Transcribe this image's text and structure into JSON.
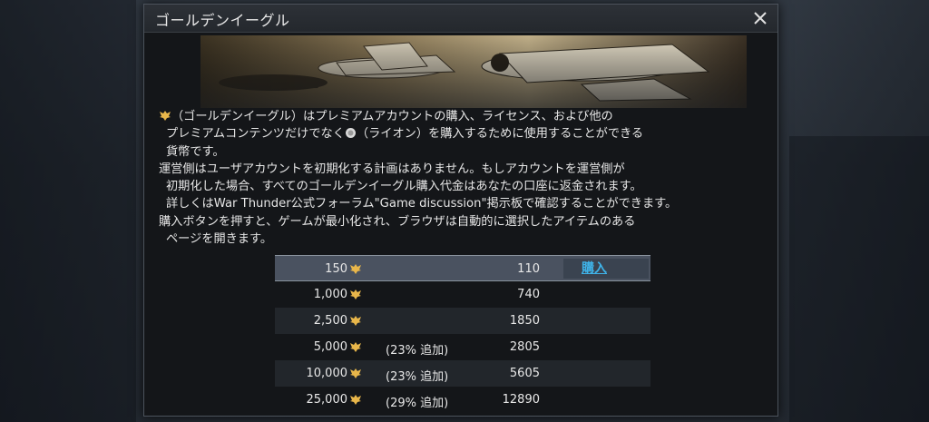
{
  "dialog": {
    "title": "ゴールデンイーグル"
  },
  "description": {
    "p1_line1": "（ゴールデンイーグル）はプレミアムアカウントの購入、ライセンス、および他の",
    "p1_line2a": "プレミアムコンテンツだけでなく",
    "p1_line2b": "（ライオン）を購入するために使用することができる",
    "p1_line3": "貨幣です。",
    "p2_line1": "運営側はユーザアカウントを初期化する計画はありません。もしアカウントを運営側が",
    "p2_line2": "初期化した場合、すべてのゴールデンイーグル購入代金はあなたの口座に返金されます。",
    "p2_line3": "詳しくはWar Thunder公式フォーラム\"Game discussion\"掲示板で確認することができます。",
    "p3_line1": "購入ボタンを押すと、ゲームが最小化され、ブラウザは自動的に選択したアイテムのある",
    "p3_line2": "ページを開きます。"
  },
  "packages": [
    {
      "amount": "150",
      "bonus": "",
      "price": "110",
      "buy_label": "購入"
    },
    {
      "amount": "1,000",
      "bonus": "",
      "price": "740"
    },
    {
      "amount": "2,500",
      "bonus": "",
      "price": "1850"
    },
    {
      "amount": "5,000",
      "bonus": "(23% 追加)",
      "price": "2805"
    },
    {
      "amount": "10,000",
      "bonus": "(23% 追加)",
      "price": "5605"
    },
    {
      "amount": "25,000",
      "bonus": "(29% 追加)",
      "price": "12890"
    }
  ],
  "icons": {
    "currency": "golden-eagle-icon",
    "lion": "lion-icon",
    "close": "close-icon"
  },
  "colors": {
    "buy_link": "#3fb3e8",
    "eagle_gold": "#e8b64a",
    "selected_row": "#4a5260"
  }
}
